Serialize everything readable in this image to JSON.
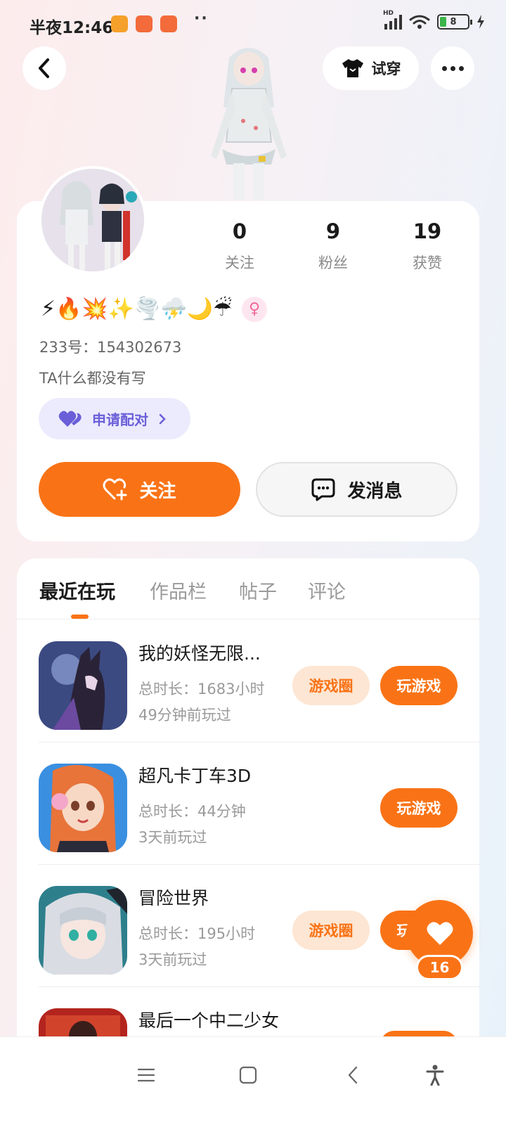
{
  "status_bar": {
    "time": "半夜12:46",
    "dots": "··",
    "battery": "8",
    "signal_label": "HD"
  },
  "header": {
    "tryon_label": "试穿"
  },
  "profile": {
    "stats": [
      {
        "value": "0",
        "label": "关注"
      },
      {
        "value": "9",
        "label": "粉丝"
      },
      {
        "value": "19",
        "label": "获赞"
      }
    ],
    "emojis": "⚡🔥💥✨🌪️⛈️🌙☔",
    "gender_symbol": "♀",
    "uid": "233号：154302673",
    "bio": "TA什么都没有写",
    "pair_label": "申请配对",
    "follow_label": "关注",
    "message_label": "发消息"
  },
  "tabs": [
    {
      "label": "最近在玩"
    },
    {
      "label": "作品栏"
    },
    {
      "label": "帖子"
    },
    {
      "label": "评论"
    }
  ],
  "games": [
    {
      "title": "我的妖怪无限...",
      "duration": "总时长：1683小时",
      "last_played": "49分钟前玩过",
      "circle_label": "游戏圈",
      "play_label": "玩游戏"
    },
    {
      "title": "超凡卡丁车3D",
      "duration": "总时长：44分钟",
      "last_played": "3天前玩过",
      "play_label": "玩游戏"
    },
    {
      "title": "冒险世界",
      "duration": "总时长：195小时",
      "last_played": "3天前玩过",
      "circle_label": "游戏圈",
      "play_label": "玩游戏"
    },
    {
      "title": "最后一个中二少女"
    }
  ],
  "like_fab": {
    "count": "16"
  },
  "colors": {
    "accent": "#f97316",
    "accent_soft": "#fde6d3",
    "pair": "#6a5fd8",
    "pair_bg": "#ecebfd"
  }
}
